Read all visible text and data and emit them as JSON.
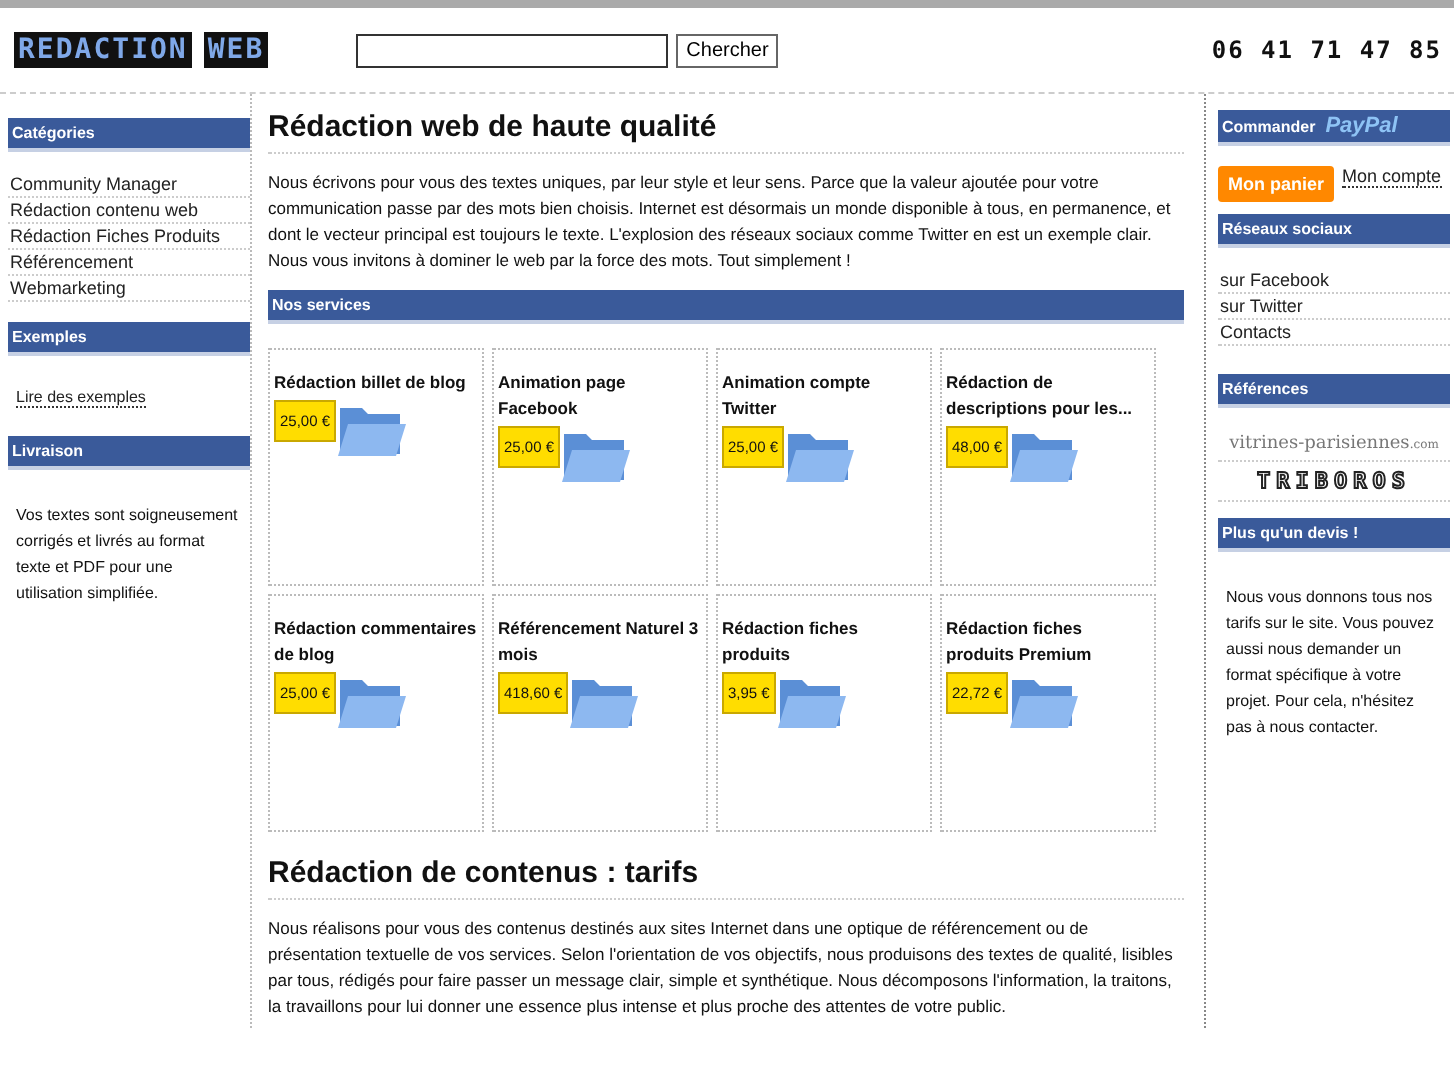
{
  "header": {
    "logo": "REDACTION WEB",
    "search": {
      "button": "Chercher"
    },
    "phone": "06 41 71 47 85"
  },
  "left": [
    {
      "title": "Catégories",
      "kind": "links",
      "items": [
        "Community Manager",
        "Rédaction contenu web",
        "Rédaction Fiches Produits",
        "Référencement",
        "Webmarketing"
      ]
    },
    {
      "title": "Exemples",
      "kind": "link",
      "items": [
        "Lire des exemples"
      ]
    },
    {
      "title": "Livraison",
      "kind": "text",
      "text": "Vos textes sont soigneusement corrigés et livrés au format texte et PDF pour une utilisation simplifiée."
    }
  ],
  "main": {
    "intro_title": "Rédaction web de haute qualité",
    "intro_text": "Nous écrivons pour vous des textes uniques, par leur style et leur sens. Parce que la valeur ajoutée pour votre communication passe par des mots bien choisis. Internet est désormais un monde disponible à tous, en permanence, et dont le vecteur principal est toujours le texte. L'explosion des réseaux sociaux comme Twitter en est un exemple clair. Nous vous invitons à dominer le web par la force des mots. Tout simplement !",
    "services_title": "Nos services",
    "services": [
      {
        "name": "Rédaction billet de blog",
        "price": "25,00 €"
      },
      {
        "name": "Animation page Facebook",
        "price": "25,00 €"
      },
      {
        "name": "Animation compte Twitter",
        "price": "25,00 €"
      },
      {
        "name": "Rédaction de descriptions pour les...",
        "price": "48,00 €"
      },
      {
        "name": "Rédaction commentaires de blog",
        "price": "25,00 €"
      },
      {
        "name": "Référencement Naturel 3 mois",
        "price": "418,60 €"
      },
      {
        "name": "Rédaction fiches produits",
        "price": "3,95 €"
      },
      {
        "name": "Rédaction fiches produits Premium",
        "price": "22,72 €"
      }
    ],
    "tarifs_title": "Rédaction de contenus : tarifs",
    "tarifs_text": "Nous réalisons pour vous des contenus destinés aux sites Internet dans une optique de référencement ou de présentation textuelle de vos services. Selon l'orientation de vos objectifs, nous produisons des textes de qualité, lisibles par tous, rédigés pour faire passer un message clair, simple et synthétique. Nous décomposons l'information, la traitons, la travaillons pour lui donner une essence plus intense et plus proche des attentes de votre public."
  },
  "right": {
    "order_title": "Commander",
    "paypal": "PayPal",
    "cart": "Mon panier",
    "account": "Mon compte",
    "social_title": "Réseaux sociaux",
    "social": [
      "sur Facebook",
      "sur Twitter",
      "Contacts"
    ],
    "refs_title": "Références",
    "refs": [
      {
        "kind": "script",
        "name": "vitrines-parisiennes",
        "suffix": ".com"
      },
      {
        "kind": "boxed",
        "name": "TRIBOROS"
      }
    ],
    "quote_title": "Plus qu'un devis !",
    "quote_text": "Nous vous donnons tous nos tarifs sur le site. Vous pouvez aussi nous demander un format spécifique à votre projet. Pour cela, n'hésitez pas à nous contacter."
  }
}
